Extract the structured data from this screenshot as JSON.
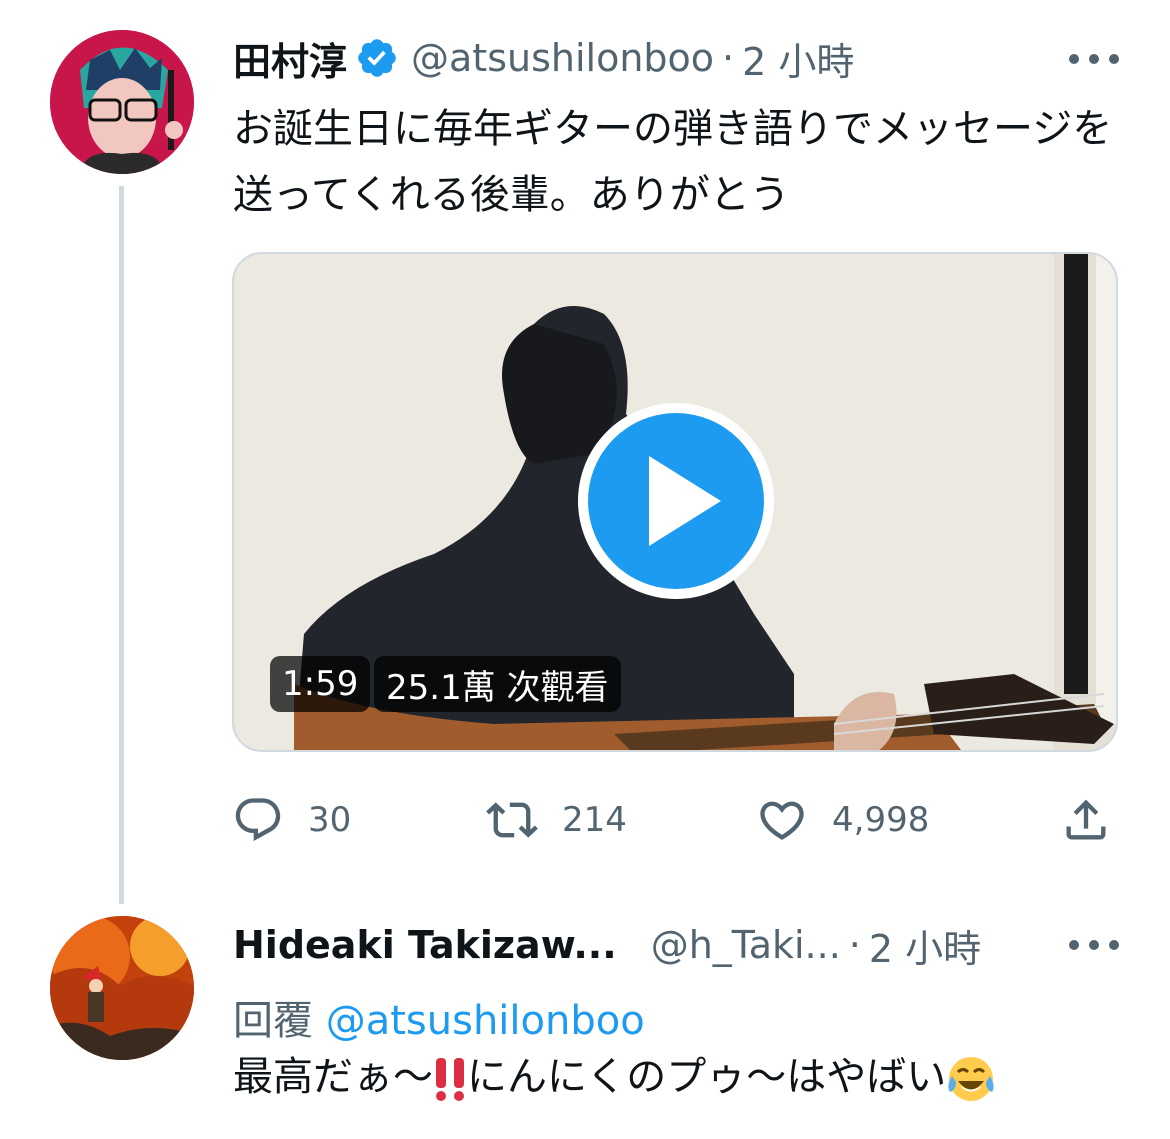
{
  "tweet": {
    "author_name": "田村淳",
    "author_handle": "@atsushilonboo",
    "separator": "·",
    "time": "2 小時",
    "text": "お誕生日に毎年ギターの弾き語りでメッセージを送ってくれる後輩。ありがとう",
    "media": {
      "duration": "1:59",
      "views": "25.1萬 次觀看"
    },
    "actions": {
      "reply_count": "30",
      "retweet_count": "214",
      "like_count": "4,998"
    }
  },
  "reply": {
    "author_name": "Hideaki Takizaw...",
    "author_handle": "@h_Taki...",
    "separator": "·",
    "time": "2 小時",
    "reply_label": "回覆",
    "reply_mention": "@atsushilonboo",
    "text_part1": "最高だぁ〜",
    "text_part2": "にんにくのプゥ〜はやばい"
  },
  "colors": {
    "accent": "#1d9bf0",
    "secondary_text": "#536471",
    "primary_text": "#0f1419",
    "thread_line": "#cfd9de"
  },
  "icons": [
    "verified-badge-icon",
    "more-options-icon",
    "play-icon",
    "reply-icon",
    "retweet-icon",
    "like-icon",
    "share-icon",
    "double-exclamation-icon",
    "laughing-tears-icon"
  ]
}
